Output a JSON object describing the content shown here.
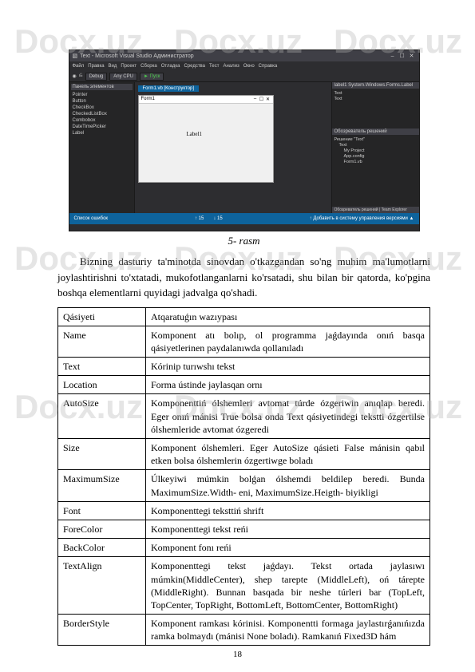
{
  "watermark": "Docx.uz",
  "screenshot": {
    "title": "Text - Microsoft Visual Studio Администратор",
    "menus": [
      "Файл",
      "Правка",
      "Вид",
      "Проект",
      "Сборка",
      "Отладка",
      "Средства",
      "Тест",
      "Анализ",
      "Окно",
      "Справка"
    ],
    "config": "Debug",
    "cpu": "Any CPU",
    "run": "► Пуск",
    "toolbox_header": "Панель элементов",
    "toolbox_items": [
      "Pointer",
      "Button",
      "CheckBox",
      "CheckedListBox",
      "Combobox",
      "DateTimePicker",
      "Label"
    ],
    "designer_tab": "Form1.vb [Конструктор]",
    "form_title": "Form1",
    "label1": "Label1",
    "right_panel_1": "label1 System.Windows.Forms.Label",
    "props": [
      "Text",
      "Text"
    ],
    "solution_header": "Обозреватель решений",
    "solution_items": [
      "Решение \"Text\"",
      "Text",
      "My Project",
      "App.config",
      "Form1.vb"
    ],
    "solution_footer": "Обозреватель решений | Team Explorer",
    "status_left": "Список ошибок",
    "status_pos1": "↑ 15",
    "status_pos2": "↓ 15",
    "status_right": "↑ Добавить в систему управления версиями ▲"
  },
  "caption": "5- rasm",
  "paragraph": "Bizning dasturiy ta'minotda sinovdan o'tkazgandan so'ng muhim ma'lumotlarni joylashtirishni to'xtatadi, mukofotlanganlarni ko'rsatadi, shu bilan bir qatorda, ko'pgina boshqa elementlarni quyidagi jadvalga qo'shadi.",
  "table": [
    {
      "k": "Qásiyeti",
      "v": "Atqaratuǵın wazıypası"
    },
    {
      "k": "Name",
      "v": "Komponent atı bolıp, ol programma jaǵdayında onıń basqa qásiyetlerinen paydalanıwda qollanıladı"
    },
    {
      "k": "Text",
      "v": "Kórinip turıwshı tekst"
    },
    {
      "k": "Location",
      "v": "Forma ústinde jaylasqan ornı"
    },
    {
      "k": "AutoSize",
      "v": "Komponenttiń ólshemleri avtomat túrde ózgeriwin anıqlap beredi. Eger onıń mánisi True bolsa onda Text qásiyetindegi tekstti ózgertilse ólshemleride avtomat ózgeredi"
    },
    {
      "k": "Size",
      "v": "Komponent ólshemleri. Eger AutoSize qásieti False mánisin qabıl etken bolsa ólshemlerin ózgertiwge boladı"
    },
    {
      "k": "MaximumSize",
      "v": "Úlkeyiwi múmkin bolǵan ólshemdi beldilep beredi. Bunda MaximumSize.Width- eni, MaximumSize.Heigth- biyikligi"
    },
    {
      "k": "Font",
      "v": "Komponenttegi teksttiń shrift"
    },
    {
      "k": "ForeColor",
      "v": "Komponenttegi tekst reńi"
    },
    {
      "k": "BackColor",
      "v": "Komponent fonı reńi"
    },
    {
      "k": "TextAlign",
      "v": "Komponenttegi tekst jaǵdayı. Tekst ortada jaylasıwı múmkin(MiddleCenter), shep tarepte (MiddleLeft), oń tárepte (MiddleRight). Bunnan basqada bir neshe túrleri bar (TopLeft, TopCenter, TopRight, BottomLeft, BottomCenter, BottomRight)"
    },
    {
      "k": "BorderStyle",
      "v": "Komponent ramkası kórinisi. Komponentti formaga jaylastırǵanıńızda ramka bolmaydı (mánisi None boladı). Ramkanıń Fixed3D hám"
    }
  ],
  "page_number": "18"
}
